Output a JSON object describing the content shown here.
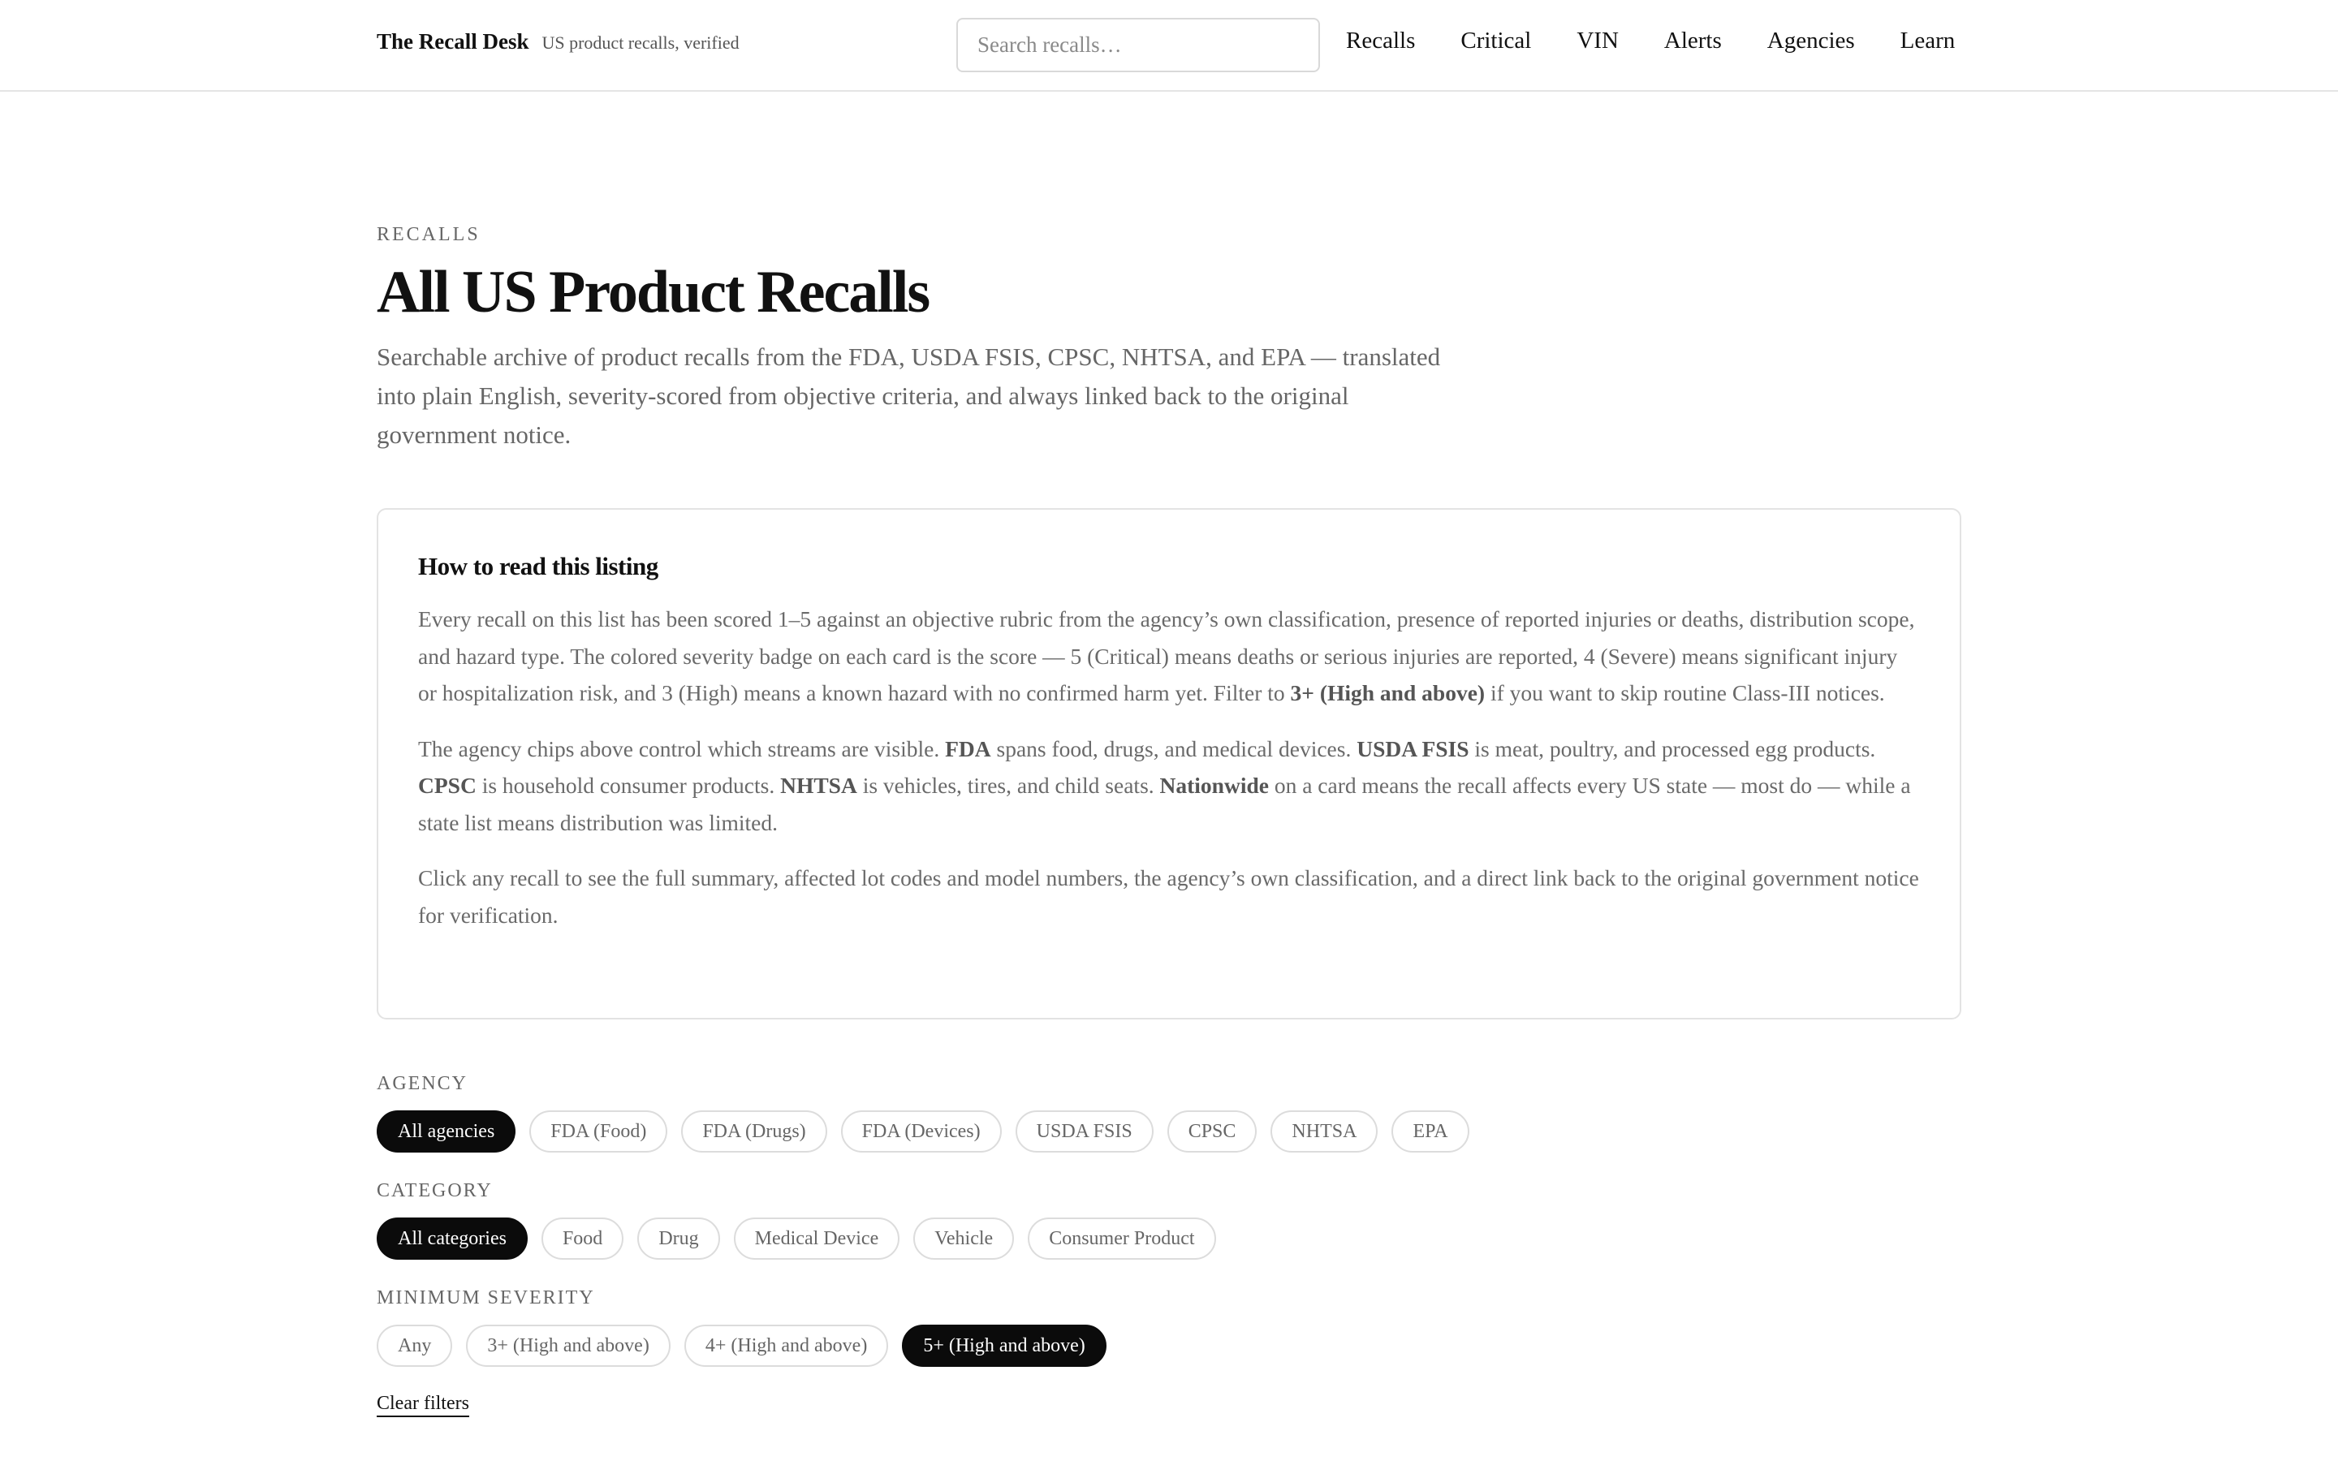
{
  "header": {
    "brand": "The Recall Desk",
    "tagline": "US product recalls, verified",
    "search_placeholder": "Search recalls…",
    "nav": [
      "Recalls",
      "Critical",
      "VIN",
      "Alerts",
      "Agencies",
      "Learn"
    ]
  },
  "hero": {
    "eyebrow": "RECALLS",
    "title": "All US Product Recalls",
    "lede": "Searchable archive of product recalls from the FDA, USDA FSIS, CPSC, NHTSA, and EPA — translated into plain English, severity-scored from objective criteria, and always linked back to the original government notice."
  },
  "howto": {
    "heading": "How to read this listing",
    "p1": {
      "a": "Every recall on this list has been scored 1–5 against an objective rubric from the agency’s own classification, presence of reported injuries or deaths, distribution scope, and hazard type. The colored severity badge on each card is the score — 5 (Critical) means deaths or serious injuries are reported, 4 (Severe) means significant injury or hospitalization risk, and 3 (High) means a known hazard with no confirmed harm yet. Filter to ",
      "b": "3+ (High and above)",
      "c": " if you want to skip routine Class-III notices."
    },
    "p2": {
      "t1": "The agency chips above control which streams are visible. ",
      "b1": "FDA",
      "t2": " spans food, drugs, and medical devices. ",
      "b2": "USDA FSIS",
      "t3": " is meat, poultry, and processed egg products. ",
      "b3": "CPSC",
      "t4": " is household consumer products. ",
      "b4": "NHTSA",
      "t5": " is vehicles, tires, and child seats. ",
      "b5": "Nationwide",
      "t6": " on a card means the recall affects every US state — most do — while a state list means distribution was limited."
    },
    "p3": "Click any recall to see the full summary, affected lot codes and model numbers, the agency’s own classification, and a direct link back to the original government notice for verification."
  },
  "filters": {
    "agency": {
      "label": "AGENCY",
      "options": [
        "All agencies",
        "FDA (Food)",
        "FDA (Drugs)",
        "FDA (Devices)",
        "USDA FSIS",
        "CPSC",
        "NHTSA",
        "EPA"
      ],
      "selected": "All agencies"
    },
    "category": {
      "label": "CATEGORY",
      "options": [
        "All categories",
        "Food",
        "Drug",
        "Medical Device",
        "Vehicle",
        "Consumer Product"
      ],
      "selected": "All categories"
    },
    "severity": {
      "label": "MINIMUM SEVERITY",
      "options": [
        "Any",
        "3+ (High and above)",
        "4+ (High and above)",
        "5+ (High and above)"
      ],
      "selected": "5+ (High and above)"
    },
    "clear_label": "Clear filters"
  }
}
